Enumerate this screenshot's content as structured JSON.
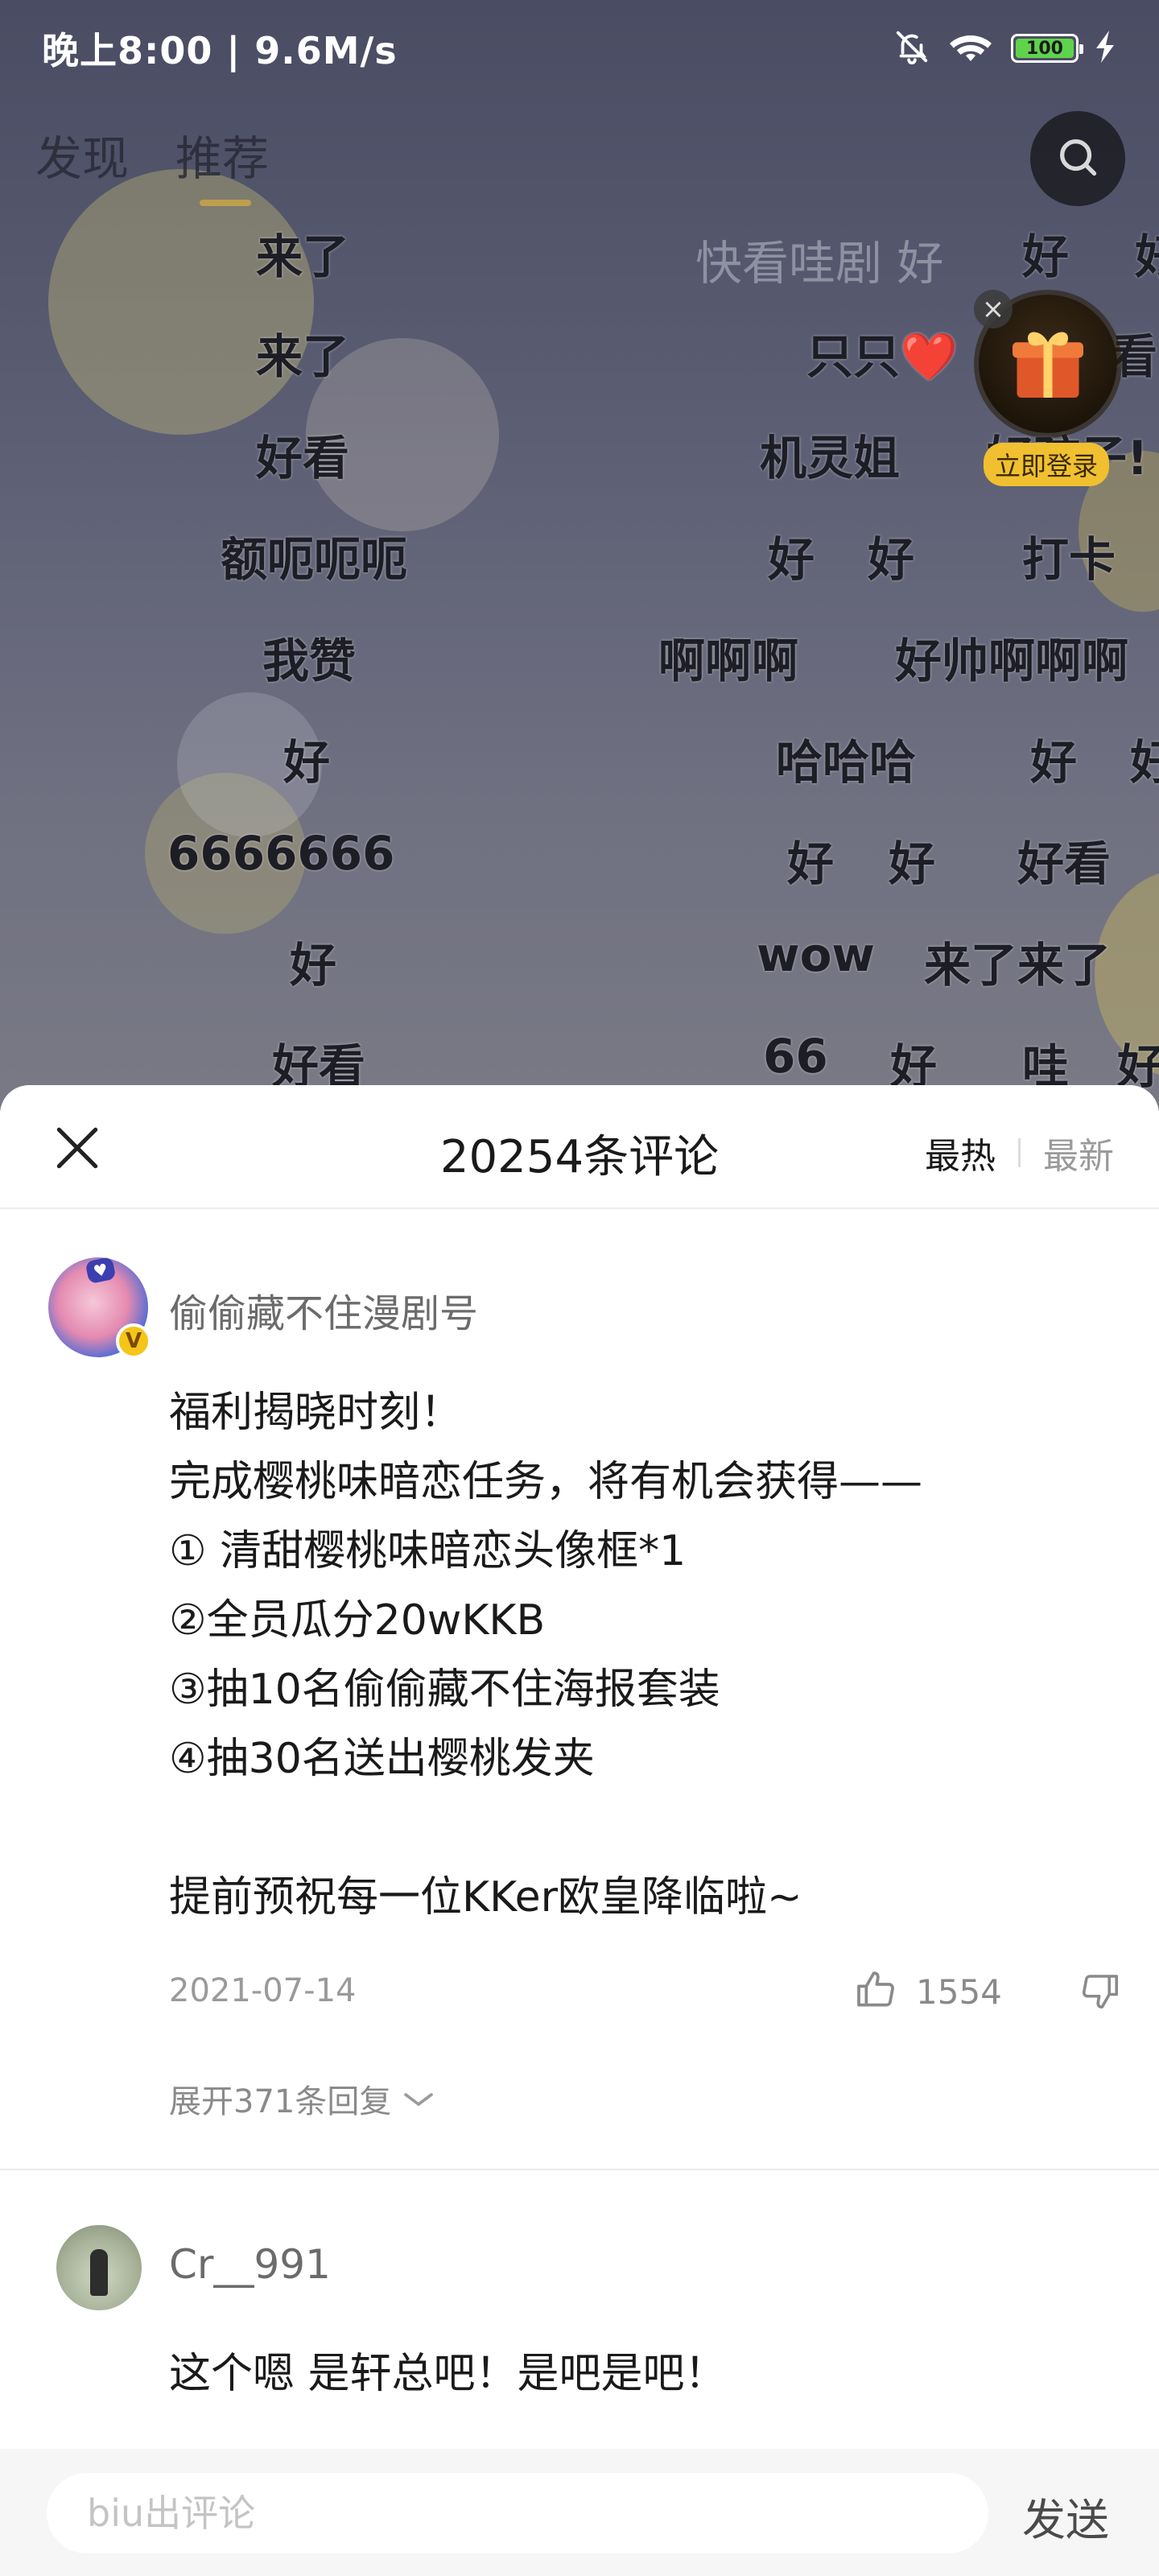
{
  "status_bar": {
    "time_speed": "晚上8:00 | 9.6M/s",
    "battery": "100",
    "icons": [
      "mute-bell-icon",
      "wifi-icon",
      "battery-icon",
      "charging-icon"
    ]
  },
  "top_tabs": [
    {
      "label": "发现"
    },
    {
      "label": "推荐"
    }
  ],
  "gift": {
    "login_label": "立即登录",
    "close": "×"
  },
  "danmaku": [
    "来了",
    "来了",
    "好看",
    "额呃呃呃",
    "我赞",
    "好",
    "6666666",
    "好",
    "好看",
    "快看哇剧 好",
    "好",
    "好",
    "只只❤️",
    "看",
    "机灵姐",
    "好孩子!",
    "好",
    "好",
    "打卡",
    "啊啊啊",
    "好帅啊啊啊",
    "哈哈哈",
    "好",
    "好",
    "好",
    "好",
    "好看",
    "wow",
    "来了来了",
    "66",
    "好",
    "哇",
    "好"
  ],
  "comments_sheet": {
    "title": "20254条评论",
    "sort_hot": "最热",
    "sort_new": "最新",
    "comments": [
      {
        "username": "偷偷藏不住漫剧号",
        "avatar_badge": "V",
        "lines": [
          "福利揭晓时刻！",
          "完成樱桃味暗恋任务，将有机会获得——",
          "① 清甜樱桃味暗恋头像框*1",
          "②全员瓜分20wKKB",
          "③抽10名偷偷藏不住海报套装",
          "④抽30名送出樱桃发夹",
          "",
          "提前预祝每一位KKer欧皇降临啦~"
        ],
        "date": "2021-07-14",
        "likes": "1554",
        "expand_label": "展开371条回复"
      },
      {
        "username": "Cr__991",
        "lines": [
          "这个嗯 是轩总吧！是吧是吧！"
        ]
      }
    ]
  },
  "input": {
    "placeholder": "biu出评论",
    "send_label": "发送"
  }
}
